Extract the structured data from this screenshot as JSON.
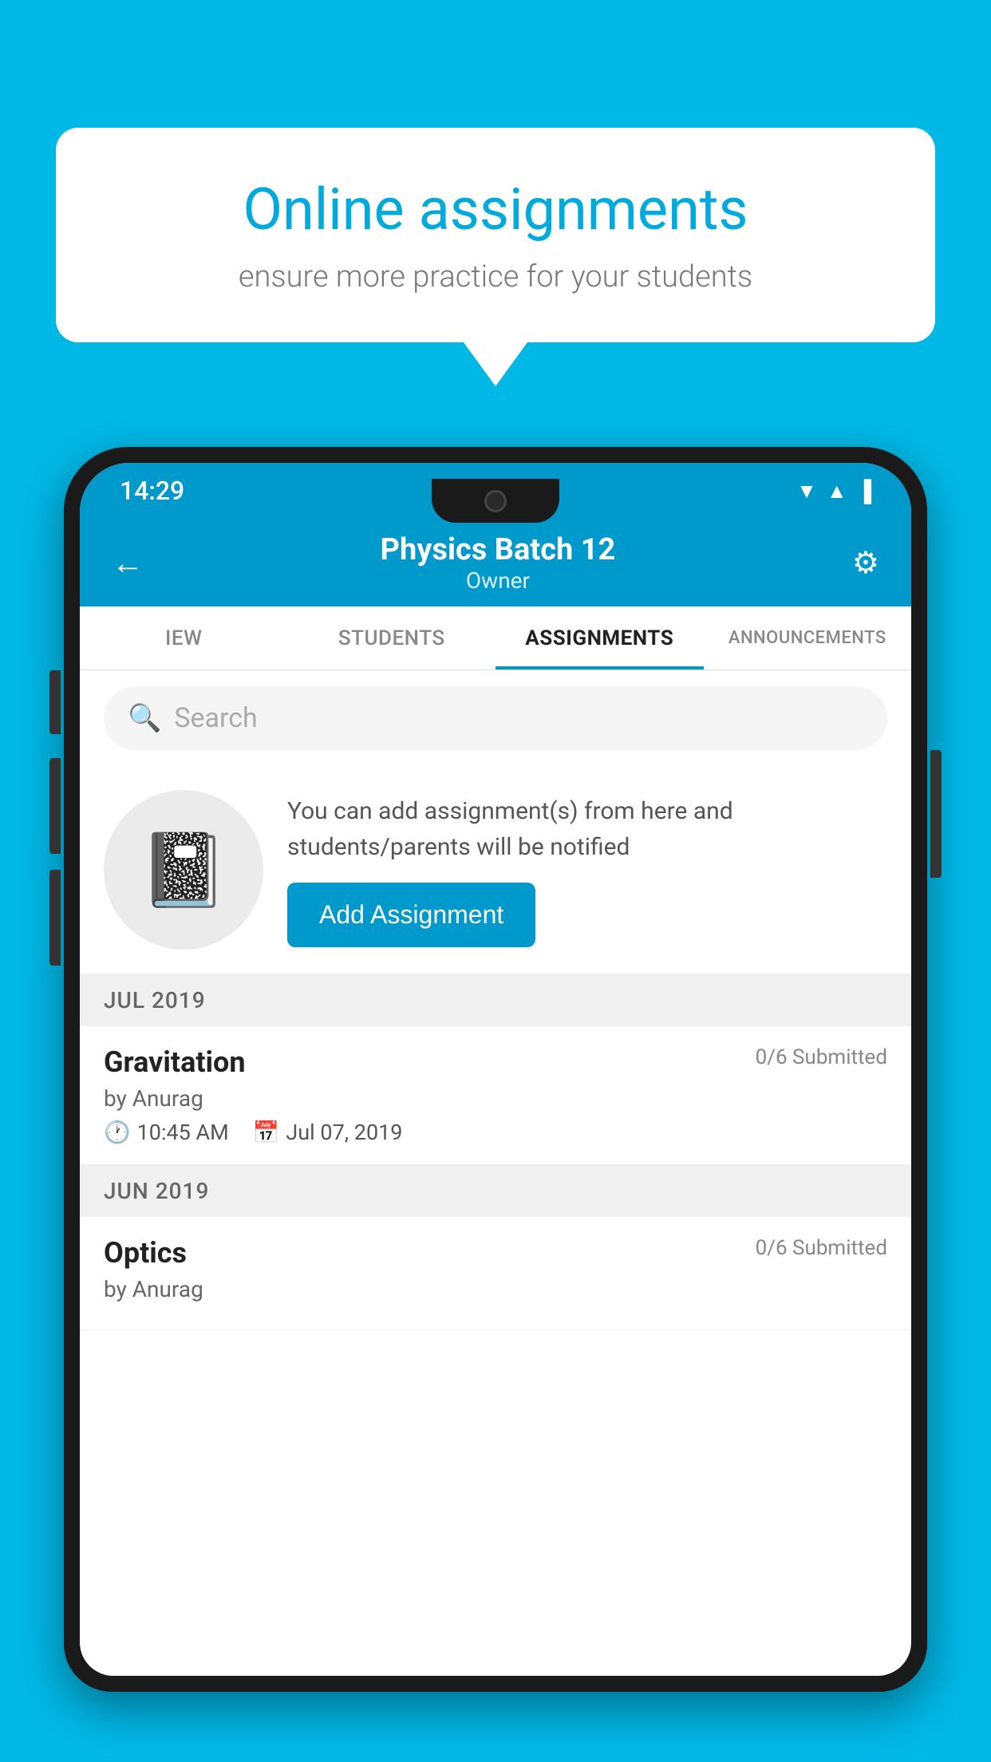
{
  "background": {
    "color": "#00B8E6"
  },
  "speech_bubble": {
    "title": "Online assignments",
    "subtitle": "ensure more practice for your students"
  },
  "status_bar": {
    "time": "14:29",
    "wifi_icon": "▼",
    "signal_icon": "▲",
    "battery_icon": "▐"
  },
  "app_header": {
    "back_icon": "←",
    "title": "Physics Batch 12",
    "subtitle": "Owner",
    "settings_icon": "⚙"
  },
  "tabs": [
    {
      "label": "IEW",
      "active": false
    },
    {
      "label": "STUDENTS",
      "active": false
    },
    {
      "label": "ASSIGNMENTS",
      "active": true
    },
    {
      "label": "ANNOUNCEMENTS",
      "active": false
    }
  ],
  "search": {
    "placeholder": "Search"
  },
  "add_assignment_card": {
    "icon": "📓",
    "description_text": "You can add assignment(s) from here and students/parents will be notified",
    "button_label": "Add Assignment"
  },
  "sections": [
    {
      "label": "JUL 2019",
      "assignments": [
        {
          "name": "Gravitation",
          "submitted": "0/6 Submitted",
          "author": "by Anurag",
          "time": "10:45 AM",
          "date": "Jul 07, 2019"
        }
      ]
    },
    {
      "label": "JUN 2019",
      "assignments": [
        {
          "name": "Optics",
          "submitted": "0/6 Submitted",
          "author": "by Anurag",
          "time": "",
          "date": ""
        }
      ]
    }
  ]
}
